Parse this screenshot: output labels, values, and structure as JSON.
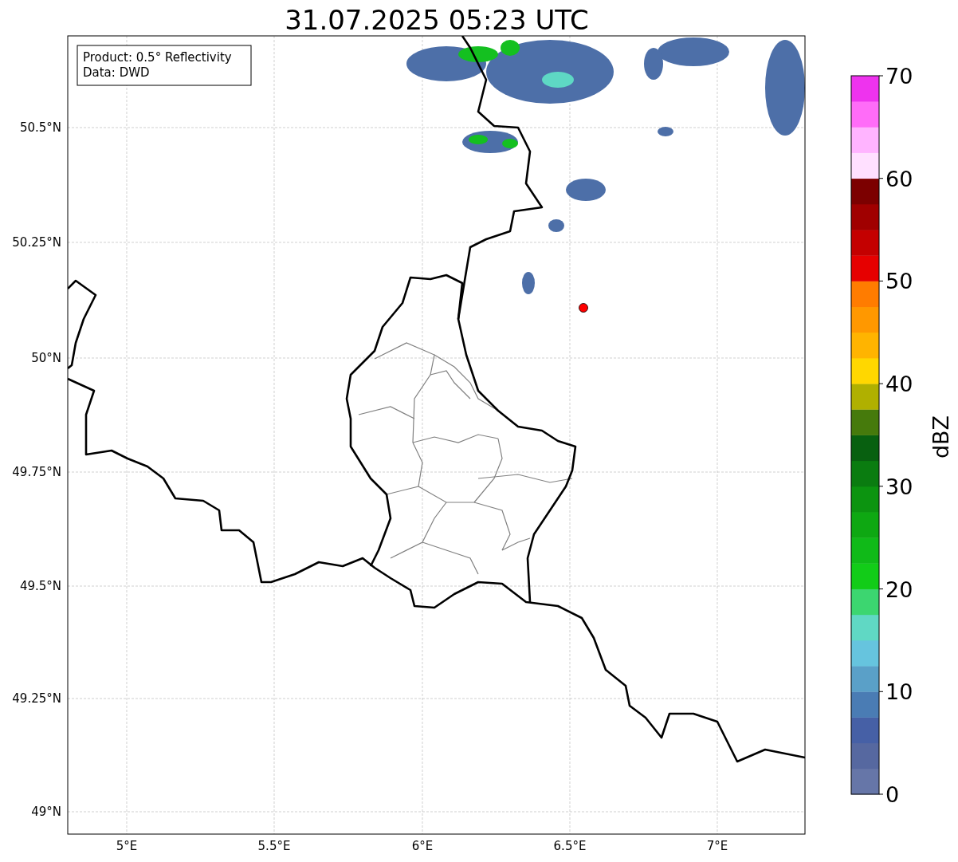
{
  "title": "31.07.2025 05:23 UTC",
  "legend": [
    "Product: 0.5° Reflectivity",
    "Data: DWD"
  ],
  "y_axis": {
    "ticks": [
      "50.5°N",
      "50.25°N",
      "50°N",
      "49.75°N",
      "49.5°N",
      "49.25°N",
      "49°N"
    ]
  },
  "x_axis": {
    "ticks": [
      "5°E",
      "5.5°E",
      "6°E",
      "6.5°E",
      "7°E"
    ]
  },
  "colorbar": {
    "label": "dBZ",
    "ticks": [
      "70",
      "60",
      "50",
      "40",
      "30",
      "20",
      "10",
      "0"
    ],
    "bands": [
      {
        "color": "#6676a8"
      },
      {
        "color": "#5668a0"
      },
      {
        "color": "#4660a6"
      },
      {
        "color": "#4a7cb4"
      },
      {
        "color": "#5aa0c8"
      },
      {
        "color": "#66c4de"
      },
      {
        "color": "#60d8c4"
      },
      {
        "color": "#3cd670"
      },
      {
        "color": "#12cc18"
      },
      {
        "color": "#10ba18"
      },
      {
        "color": "#0ea812"
      },
      {
        "color": "#0c9410"
      },
      {
        "color": "#0a7c10"
      },
      {
        "color": "#086010"
      },
      {
        "color": "#467a0c"
      },
      {
        "color": "#b0b000"
      },
      {
        "color": "#ffd700"
      },
      {
        "color": "#ffb400"
      },
      {
        "color": "#ff9800"
      },
      {
        "color": "#ff7c00"
      },
      {
        "color": "#e60000"
      },
      {
        "color": "#c40000"
      },
      {
        "color": "#a00000"
      },
      {
        "color": "#7c0000"
      },
      {
        "color": "#ffe0ff"
      },
      {
        "color": "#ffb4ff"
      },
      {
        "color": "#ff6cf8"
      },
      {
        "color": "#ee33ee"
      }
    ]
  }
}
